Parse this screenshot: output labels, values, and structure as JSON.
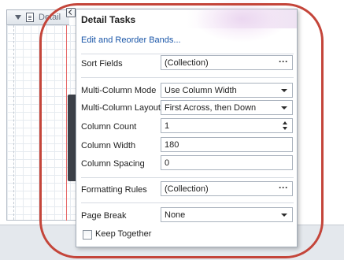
{
  "band": {
    "label": "Detail",
    "icon": "document-icon",
    "expand_icon": "collapse-triangle-icon"
  },
  "smart_tag": {
    "icon": "smart-tag-arrow-icon"
  },
  "panel": {
    "title": "Detail Tasks",
    "edit_link": "Edit and Reorder Bands...",
    "sort_fields": {
      "label": "Sort Fields",
      "value": "(Collection)",
      "button": "···"
    },
    "multi_column_mode": {
      "label": "Multi-Column Mode",
      "value": "Use Column Width"
    },
    "multi_column_layout": {
      "label": "Multi-Column Layout",
      "value": "First Across, then Down"
    },
    "column_count": {
      "label": "Column Count",
      "value": "1"
    },
    "column_width": {
      "label": "Column Width",
      "value": "180"
    },
    "column_spacing": {
      "label": "Column Spacing",
      "value": "0"
    },
    "formatting_rules": {
      "label": "Formatting Rules",
      "value": "(Collection)",
      "button": "···"
    },
    "page_break": {
      "label": "Page Break",
      "value": "None"
    },
    "keep_together": {
      "label": "Keep Together",
      "checked": false
    }
  },
  "colors": {
    "link": "#1a56a8",
    "highlight_annotation": "#c4453a",
    "panel_border": "#a3acb8"
  }
}
